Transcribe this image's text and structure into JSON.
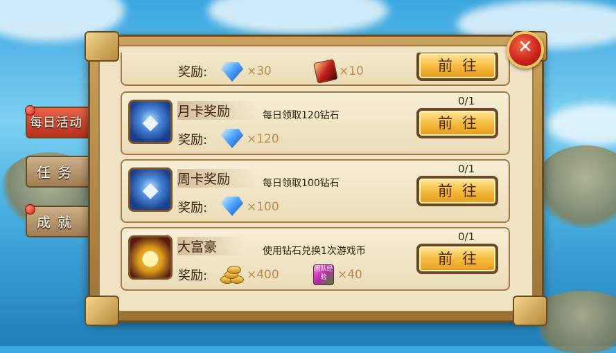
{
  "close_icon": "close-icon",
  "side_tabs": [
    {
      "label": "每日活动",
      "active": true
    },
    {
      "label": "任务",
      "active": false
    },
    {
      "label": "成就",
      "active": false
    }
  ],
  "reward_label": "奖励:",
  "go_label": "前往",
  "rows": [
    {
      "title": "",
      "description": "",
      "progress": "",
      "rewards": [
        {
          "icon": "diamond-icon",
          "qty": "×30"
        },
        {
          "icon": "card-item-icon",
          "qty": "×10"
        }
      ]
    },
    {
      "title": "月卡奖励",
      "description": "每日领取120钻石",
      "progress": "0/1",
      "rewards": [
        {
          "icon": "diamond-icon",
          "qty": "×120"
        }
      ]
    },
    {
      "title": "周卡奖励",
      "description": "每日领取100钻石",
      "progress": "0/1",
      "rewards": [
        {
          "icon": "diamond-icon",
          "qty": "×100"
        }
      ]
    },
    {
      "title": "大富豪",
      "description": "使用钻石兑换1次游戏币",
      "progress": "0/1",
      "rewards": [
        {
          "icon": "gold-coins-icon",
          "qty": "×400"
        },
        {
          "icon": "team-exp-icon",
          "qty": "×40",
          "item_text": "团队经验"
        }
      ]
    }
  ]
}
